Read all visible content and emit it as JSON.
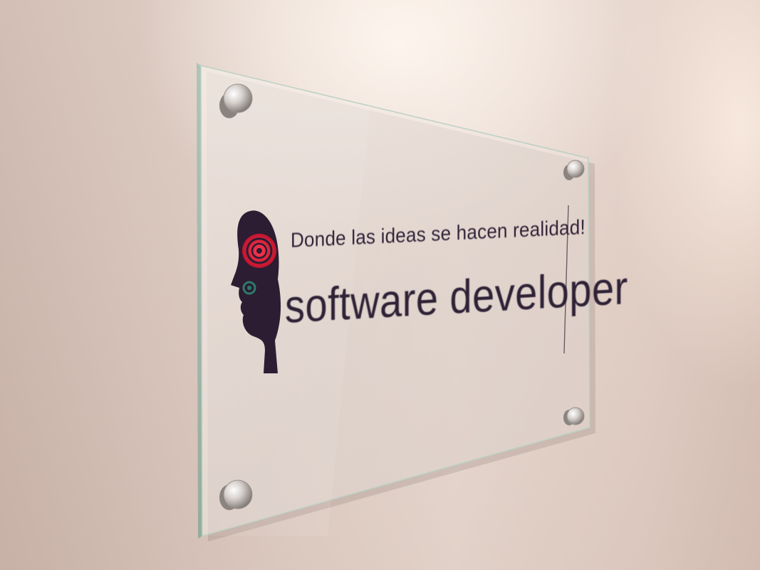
{
  "plaque": {
    "headline": "Donde las ideas se hacen realidad!",
    "title": "software developer"
  },
  "colors": {
    "wall": "#e3d2c8",
    "text": "#2f2236",
    "head_silhouette": "#2c1d33",
    "brain_accent": "#d8203a",
    "gear_accent": "#2c7a6b"
  },
  "icons": {
    "logo": "head-with-brain-target-icon"
  }
}
